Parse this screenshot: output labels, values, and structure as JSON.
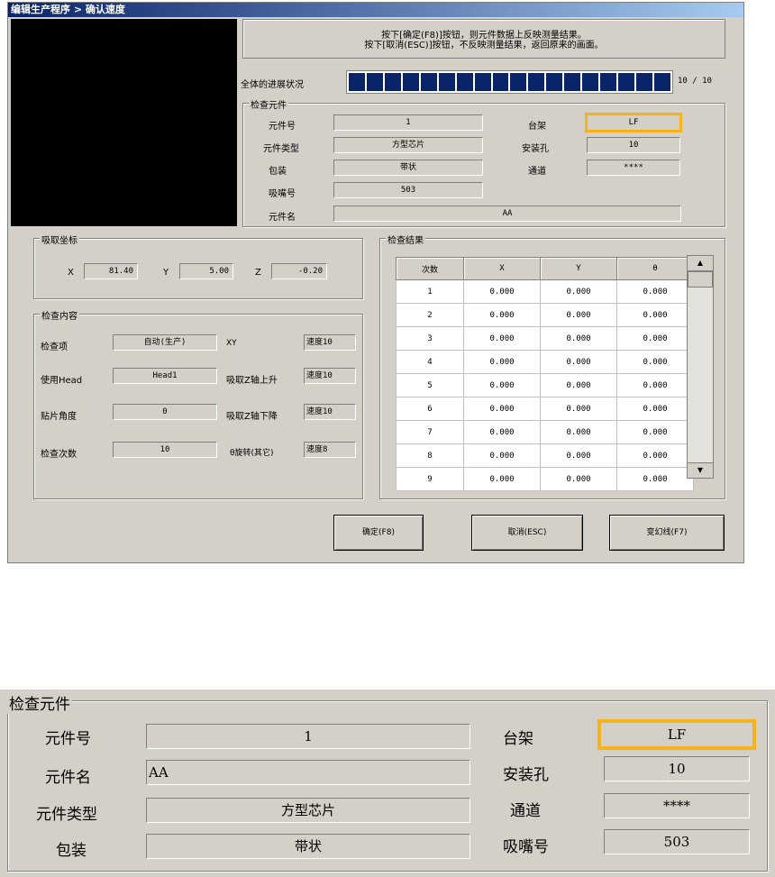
{
  "window": {
    "title": "编辑生产程序 > 确认速度"
  },
  "message": {
    "line1": "按下[确定(F8)]按钮，则元件数据上反映测量结果。",
    "line2": "按下[取消(ESC)]按钮，不反映测量结果，返回原来的画面。"
  },
  "progress": {
    "label": "全体的进展状况",
    "text": "10 / 10",
    "value": 10,
    "max": 10
  },
  "component": {
    "group_title": "检查元件",
    "part_no_label": "元件号",
    "part_no": "1",
    "part_type_label": "元件类型",
    "part_type": "方型芯片",
    "package_label": "包装",
    "package": "带状",
    "nozzle_label": "吸嘴号",
    "nozzle": "503",
    "part_name_label": "元件名",
    "part_name": "AA",
    "rack_label": "台架",
    "rack": "LF",
    "hole_label": "安装孔",
    "hole": "10",
    "channel_label": "通道",
    "channel": "****"
  },
  "pickup": {
    "group_title": "吸取坐标",
    "x_label": "X",
    "x": "81.40",
    "y_label": "Y",
    "y": "5.00",
    "z_label": "Z",
    "z": "-0.20"
  },
  "inspection": {
    "group_title": "检查内容",
    "item_label": "检查项",
    "item": "自动(生产)",
    "xy_label": "XY",
    "xy_speed": "速度10",
    "head_label": "使用Head",
    "head": "Head1",
    "zup_label": "吸取Z轴上升",
    "zup_speed": "速度10",
    "angle_label": "贴片角度",
    "angle": "0",
    "zdown_label": "吸取Z轴下降",
    "zdown_speed": "速度10",
    "count_label": "检查次数",
    "count": "10",
    "rot_label": "θ旋转(其它)",
    "rot_speed": "速度8"
  },
  "results": {
    "group_title": "检查结果",
    "headers": [
      "次数",
      "X",
      "Y",
      "θ"
    ],
    "rows": [
      [
        "1",
        "0.000",
        "0.000",
        "0.000"
      ],
      [
        "2",
        "0.000",
        "0.000",
        "0.000"
      ],
      [
        "3",
        "0.000",
        "0.000",
        "0.000"
      ],
      [
        "4",
        "0.000",
        "0.000",
        "0.000"
      ],
      [
        "5",
        "0.000",
        "0.000",
        "0.000"
      ],
      [
        "6",
        "0.000",
        "0.000",
        "0.000"
      ],
      [
        "7",
        "0.000",
        "0.000",
        "0.000"
      ],
      [
        "8",
        "0.000",
        "0.000",
        "0.000"
      ],
      [
        "9",
        "0.000",
        "0.000",
        "0.000"
      ]
    ]
  },
  "buttons": {
    "ok": "确定(F8)",
    "cancel": "取消(ESC)",
    "change": "变幻线(F7)"
  },
  "zoom": {
    "group_title": "检查元件",
    "part_no_label": "元件号",
    "part_no": "1",
    "part_name_label": "元件名",
    "part_name": "AA",
    "part_type_label": "元件类型",
    "part_type": "方型芯片",
    "package_label": "包装",
    "package": "带状",
    "rack_label": "台架",
    "rack": "LF",
    "hole_label": "安装孔",
    "hole": "10",
    "channel_label": "通道",
    "channel": "****",
    "nozzle_label": "吸嘴号",
    "nozzle": "503"
  },
  "colors": {
    "highlight": "#f5b31a",
    "progress_fill": "#0a246a",
    "dialog_bg": "#d4d0c8"
  }
}
